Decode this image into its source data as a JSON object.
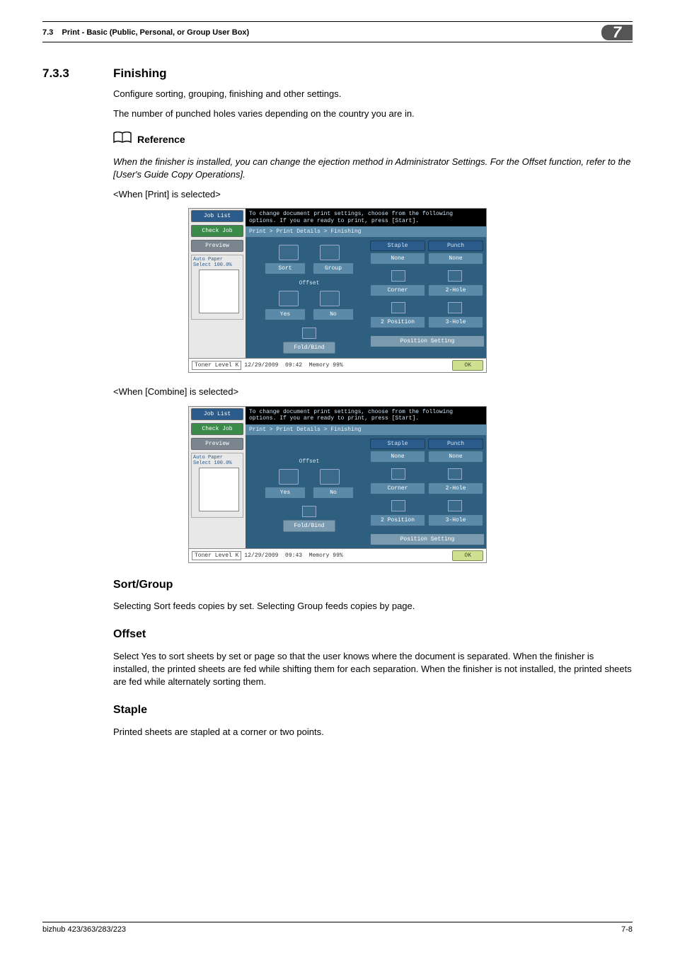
{
  "header": {
    "left": "7.3",
    "title": "Print - Basic (Public, Personal, or Group User Box)",
    "chapter": "7"
  },
  "section": {
    "num": "7.3.3",
    "title": "Finishing"
  },
  "intro": {
    "p1": "Configure sorting, grouping, finishing and other settings.",
    "p2": "The number of punched holes varies depending on the country you are in."
  },
  "reference": {
    "label": "Reference",
    "text": "When the finisher is installed, you can change the ejection method in Administrator Settings. For the Offset function, refer to the [User's Guide Copy Operations]."
  },
  "caption1": "<When [Print] is selected>",
  "caption2": "<When [Combine] is selected>",
  "panel": {
    "jobList": "Job List",
    "checkJob": "Check Job",
    "preview": "Preview",
    "autoPaper": "Auto Paper Select  100.0%",
    "instr": "To change document print settings, choose from the following options. If you are ready to print, press [Start].",
    "crumb": "Print > Print Details > Finishing",
    "sort": "Sort",
    "group": "Group",
    "offset": "Offset",
    "yes": "Yes",
    "no": "No",
    "foldBind": "Fold/Bind",
    "staple": "Staple",
    "punch": "Punch",
    "none": "None",
    "corner": "Corner",
    "twoHole": "2-Hole",
    "twoPosition": "2 Position",
    "threeHole": "3-Hole",
    "positionSetting": "Position Setting",
    "toner": "Toner Level  K",
    "date1": "12/29/2009",
    "time1": "09:42",
    "date2": "12/29/2009",
    "time2": "09:43",
    "memory": "Memory",
    "memval": "99%",
    "ok": "OK"
  },
  "sub": {
    "sortGroup": {
      "h": "Sort/Group",
      "p": "Selecting Sort feeds copies by set. Selecting Group feeds copies by page."
    },
    "offset": {
      "h": "Offset",
      "p": "Select Yes to sort sheets by set or page so that the user knows where the document is separated. When the finisher is installed, the printed sheets are fed while shifting them for each separation. When the finisher is not installed, the printed sheets are fed while alternately sorting them."
    },
    "staple": {
      "h": "Staple",
      "p": "Printed sheets are stapled at a corner or two points."
    }
  },
  "footer": {
    "left": "bizhub 423/363/283/223",
    "right": "7-8"
  }
}
